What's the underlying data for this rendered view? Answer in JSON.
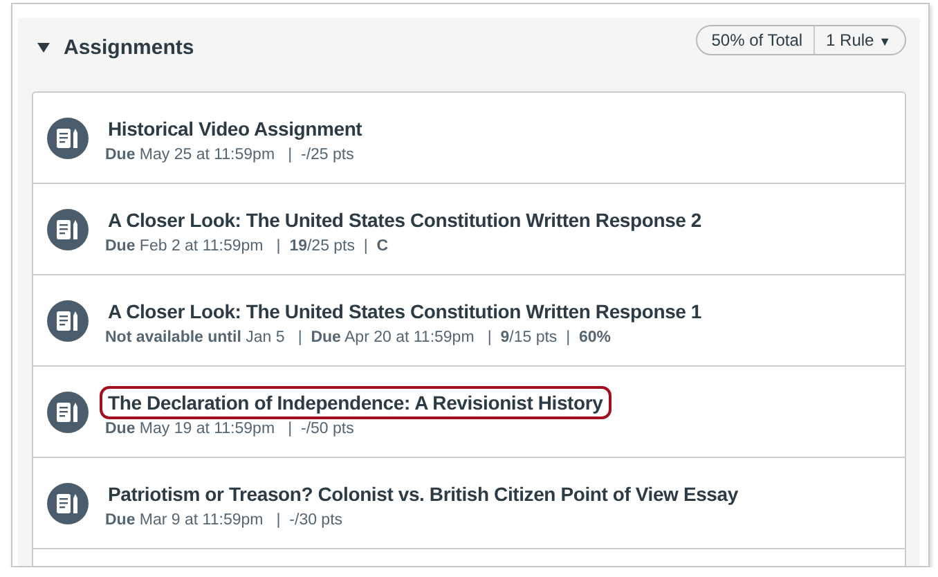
{
  "group": {
    "title": "Assignments",
    "expanded": true,
    "weight": "50% of Total",
    "rules": "1 Rule",
    "rules_caret": "▼"
  },
  "assignments": [
    {
      "title": "Historical Video Assignment",
      "meta": "**Due** May 25 at 11:59pm   |  -/25 pts",
      "highlighted": false
    },
    {
      "title": "A Closer Look: The United States Constitution Written Response 2",
      "meta": "**Due** Feb 2 at 11:59pm   |  **19**/25 pts  |  **C**",
      "highlighted": false
    },
    {
      "title": "A Closer Look: The United States Constitution Written Response 1",
      "meta": "**Not available until** Jan 5   |  **Due** Apr 20 at 11:59pm   |  **9**/15 pts  |  **60%**",
      "highlighted": false
    },
    {
      "title": "The Declaration of Independence: A Revisionist History",
      "meta": "**Due** May 19 at 11:59pm   |  -/50 pts",
      "highlighted": true
    },
    {
      "title": "Patriotism or Treason? Colonist vs. British Citizen Point of View Essay",
      "meta": "**Due** Mar 9 at 11:59pm   |  -/30 pts",
      "highlighted": false
    }
  ]
}
